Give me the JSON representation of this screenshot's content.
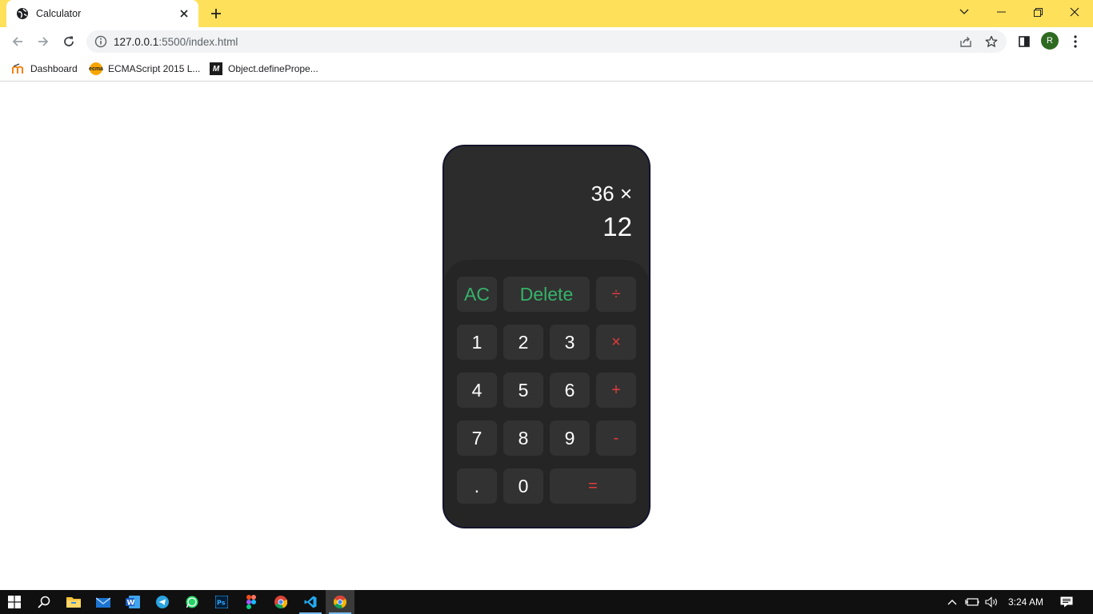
{
  "browser": {
    "tab_title": "Calculator",
    "url_host": "127.0.0.1",
    "url_rest": ":5500/index.html",
    "profile_initial": "R",
    "bookmarks": [
      {
        "label": "Dashboard",
        "icon": "moodle-icon"
      },
      {
        "label": "ECMAScript 2015 L...",
        "icon": "ecma-icon"
      },
      {
        "label": "Object.definePrope...",
        "icon": "mdn-icon"
      }
    ],
    "theme_color": "#ffe05a"
  },
  "calculator": {
    "previous_operand": "36 ×",
    "current_operand": "12",
    "keys": {
      "ac": "AC",
      "delete": "Delete",
      "divide": "÷",
      "one": "1",
      "two": "2",
      "three": "3",
      "multiply": "×",
      "four": "4",
      "five": "5",
      "six": "6",
      "plus": "+",
      "seven": "7",
      "eight": "8",
      "nine": "9",
      "minus": "-",
      "dot": ".",
      "zero": "0",
      "equals": "="
    },
    "colors": {
      "body": "#2c2c2c",
      "keypad": "#252525",
      "key": "#323232",
      "function_text": "#36b26a",
      "operator_text": "#e23b3b"
    }
  },
  "taskbar": {
    "time": "3:24 AM"
  }
}
